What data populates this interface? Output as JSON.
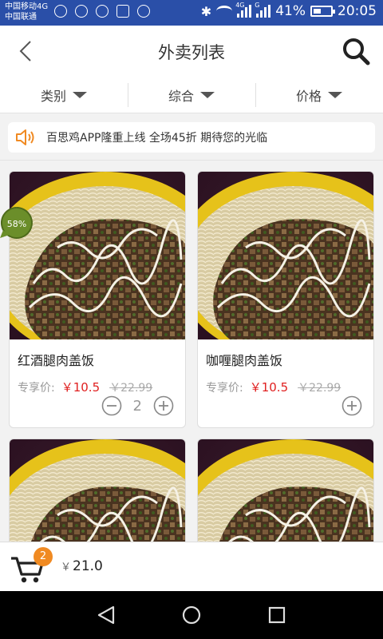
{
  "status_bar": {
    "carrier1": "中国移动4G",
    "carrier2": "中国联通",
    "battery": "41%",
    "time": "20:05",
    "net1": "4G",
    "net2": "G"
  },
  "header": {
    "title": "外卖列表",
    "back_icon": "chevron-left-icon",
    "search_icon": "search-icon"
  },
  "filters": [
    {
      "label": "类别"
    },
    {
      "label": "综合"
    },
    {
      "label": "价格"
    }
  ],
  "notice": {
    "icon": "speaker-icon",
    "text": "百思鸡APP隆重上线  全场45折  期待您的光临"
  },
  "overlay_badge": "58%",
  "products": [
    {
      "name": "红酒腿肉盖饭",
      "price_label": "专享价:",
      "price": "￥10.5",
      "old_price": "￥22.99",
      "quantity": "2"
    },
    {
      "name": "咖喱腿肉盖饭",
      "price_label": "专享价:",
      "price": "￥10.5",
      "old_price": "￥22.99",
      "quantity": ""
    },
    {
      "name": "",
      "price_label": "",
      "price": "",
      "old_price": "",
      "quantity": ""
    },
    {
      "name": "",
      "price_label": "",
      "price": "",
      "old_price": "",
      "quantity": ""
    }
  ],
  "cart": {
    "count": "2",
    "currency": "￥",
    "total": "21.0"
  },
  "colors": {
    "accent": "#f08a22",
    "price": "#e02020",
    "status_bar": "#2a4fa8"
  }
}
